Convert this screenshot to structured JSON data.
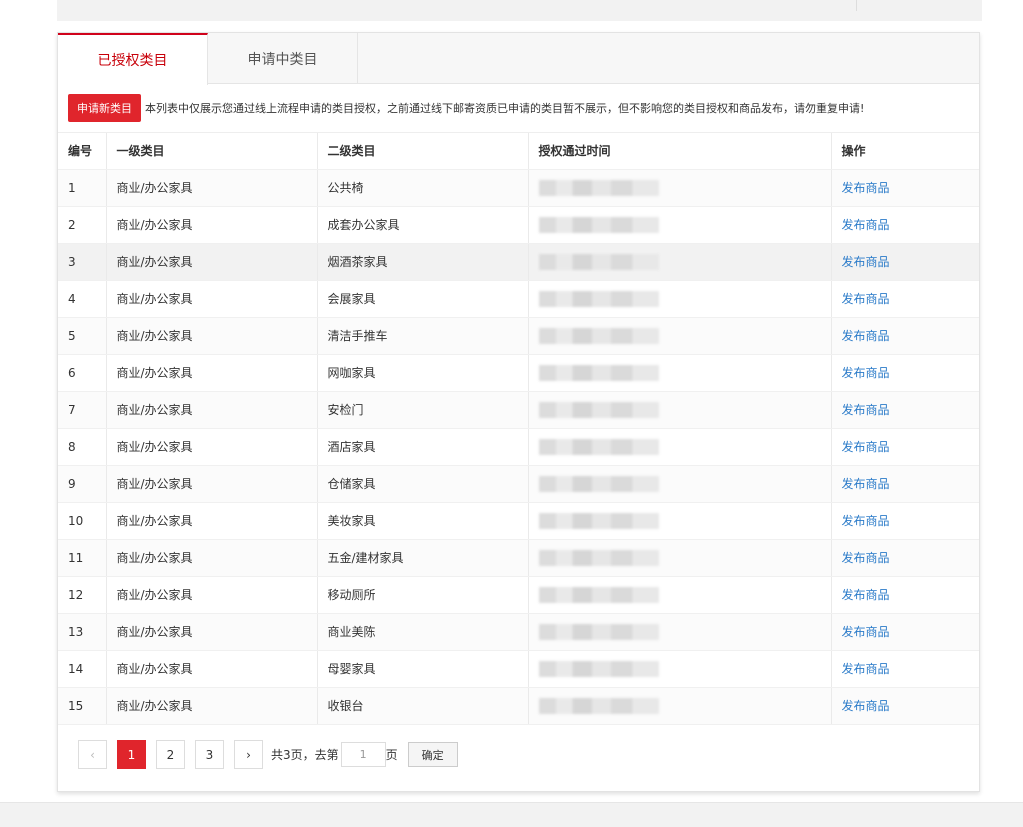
{
  "tabs": [
    {
      "label": "已授权类目"
    },
    {
      "label": "申请中类目"
    }
  ],
  "notice": {
    "apply_button": "申请新类目",
    "text": "本列表中仅展示您通过线上流程申请的类目授权，之前通过线下邮寄资质已申请的类目暂不展示，但不影响您的类目授权和商品发布，请勿重复申请!"
  },
  "table": {
    "headers": [
      "编号",
      "一级类目",
      "二级类目",
      "授权通过时间",
      "操作"
    ],
    "rows": [
      {
        "no": "1",
        "level1": "商业/办公家具",
        "level2": "公共椅",
        "action": "发布商品"
      },
      {
        "no": "2",
        "level1": "商业/办公家具",
        "level2": "成套办公家具",
        "action": "发布商品"
      },
      {
        "no": "3",
        "level1": "商业/办公家具",
        "level2": "烟酒茶家具",
        "action": "发布商品"
      },
      {
        "no": "4",
        "level1": "商业/办公家具",
        "level2": "会展家具",
        "action": "发布商品"
      },
      {
        "no": "5",
        "level1": "商业/办公家具",
        "level2": "清洁手推车",
        "action": "发布商品"
      },
      {
        "no": "6",
        "level1": "商业/办公家具",
        "level2": "网咖家具",
        "action": "发布商品"
      },
      {
        "no": "7",
        "level1": "商业/办公家具",
        "level2": "安检门",
        "action": "发布商品"
      },
      {
        "no": "8",
        "level1": "商业/办公家具",
        "level2": "酒店家具",
        "action": "发布商品"
      },
      {
        "no": "9",
        "level1": "商业/办公家具",
        "level2": "仓储家具",
        "action": "发布商品"
      },
      {
        "no": "10",
        "level1": "商业/办公家具",
        "level2": "美妆家具",
        "action": "发布商品"
      },
      {
        "no": "11",
        "level1": "商业/办公家具",
        "level2": "五金/建材家具",
        "action": "发布商品"
      },
      {
        "no": "12",
        "level1": "商业/办公家具",
        "level2": "移动厕所",
        "action": "发布商品"
      },
      {
        "no": "13",
        "level1": "商业/办公家具",
        "level2": "商业美陈",
        "action": "发布商品"
      },
      {
        "no": "14",
        "level1": "商业/办公家具",
        "level2": "母婴家具",
        "action": "发布商品"
      },
      {
        "no": "15",
        "level1": "商业/办公家具",
        "level2": "收银台",
        "action": "发布商品"
      }
    ]
  },
  "pagination": {
    "prev": "‹",
    "pages": [
      "1",
      "2",
      "3"
    ],
    "current": "1",
    "next": "›",
    "total_text": "共3页，去第",
    "input_value": "1",
    "page_suffix": "页",
    "confirm": "确定"
  },
  "colors": {
    "accent": "#e0252c",
    "active_tab_text": "#c8000a",
    "link": "#2b7bc9"
  }
}
